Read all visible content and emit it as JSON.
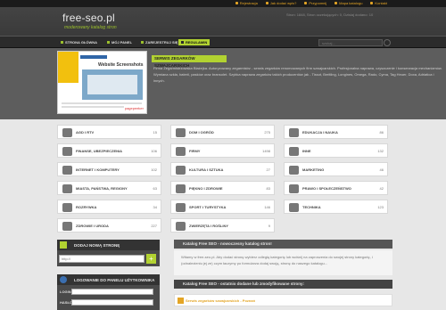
{
  "top_links": [
    "Rejestracja",
    "Jak dodać wpis?",
    "Przypomnij",
    "Mapa katalogu",
    "Kontakt"
  ],
  "header": {
    "logo": "free-seo.pl",
    "tagline": "moderowany katalog stron",
    "stats": "Stron: 1848, Stron oczekujących: 0, Dzisiaj dodano: 10"
  },
  "nav": {
    "items": [
      "STRONA GŁÓWNA",
      "MÓJ PANEL",
      "ZAREJESTRUJ SIĘ",
      "REGULAMIN"
    ],
    "search_placeholder": "szukaj..."
  },
  "featured": {
    "title": "SERWIS ZEGARKÓW SZWAJCARSKICH",
    "description": "Firma Zegarmistrzowska Błażejka. Autoryzowany zegarmistrz - serwis zegarków renomowanych firm szwajcarskich. Profesjonalna naprawa, czyszczenie i konserwacja mechanizmów. Wymiana szkła, baterii, pasków oraz bransolet. Szybka naprawa zegarków takich producentów jak - Tissot, Breitling, Longines, Omega, Rado, Cyma, Tag Heuer, Doxa, Adriatica i innych.",
    "thumb_title": "Website Screenshots",
    "thumb_banner": "POLECANY",
    "thumb_footer": "pagepeeker"
  },
  "categories": [
    {
      "label": "AGD I RTV",
      "count": "15"
    },
    {
      "label": "DOM I OGRÓD",
      "count": "275"
    },
    {
      "label": "EDUKACJA I NAUKA",
      "count": "86"
    },
    {
      "label": "FINANSE, UBEZPIECZENIA",
      "count": "106"
    },
    {
      "label": "FIRMY",
      "count": "1498"
    },
    {
      "label": "INNE",
      "count": "132"
    },
    {
      "label": "INTERNET I KOMPUTERY",
      "count": "102"
    },
    {
      "label": "KULTURA I SZTUKA",
      "count": "27"
    },
    {
      "label": "MARKETING",
      "count": "46"
    },
    {
      "label": "MIASTA, PAŃSTWA, REGIONY",
      "count": "63"
    },
    {
      "label": "PIĘKNO I ZDROWIE",
      "count": "83"
    },
    {
      "label": "PRAWO I SPOŁECZEŃSTWO",
      "count": "42"
    },
    {
      "label": "ROZRYWKA",
      "count": "34"
    },
    {
      "label": "SPORT I TURYSTYKA",
      "count": "146"
    },
    {
      "label": "TECHNIKA",
      "count": "123"
    },
    {
      "label": "ZDROWIE I URODA",
      "count": "227"
    },
    {
      "label": "ZWIERZĘTA I ROŚLINY",
      "count": "9"
    }
  ],
  "add_site": {
    "title": "DODAJ NOWĄ STRONĘ",
    "url_placeholder": "http://",
    "button": "+"
  },
  "login": {
    "title": "LOGOWANIE DO PANELU UŻYTKOWNIKA",
    "login_label": "LOGIN",
    "password_label": "HASŁO"
  },
  "right": {
    "heading1": "Katalog Free SEO - nowoczesny katalog stron!",
    "description": "Witamy w free-seo.pl. Aby dodać stronę wybierz odległą kategorię lub wciśnij na zaproszenia do swojej strony kategorię, i (odnalezieniu jej ze) czym łaczymy po formularza dodaj swoją, stronę do naszego katalogu...",
    "heading2": "Katalog Free SEO - ostatnio dodane lub zmodyfikowane strony:",
    "recent_item": "Serwis zegarków szwajcarskich - Poznań"
  }
}
